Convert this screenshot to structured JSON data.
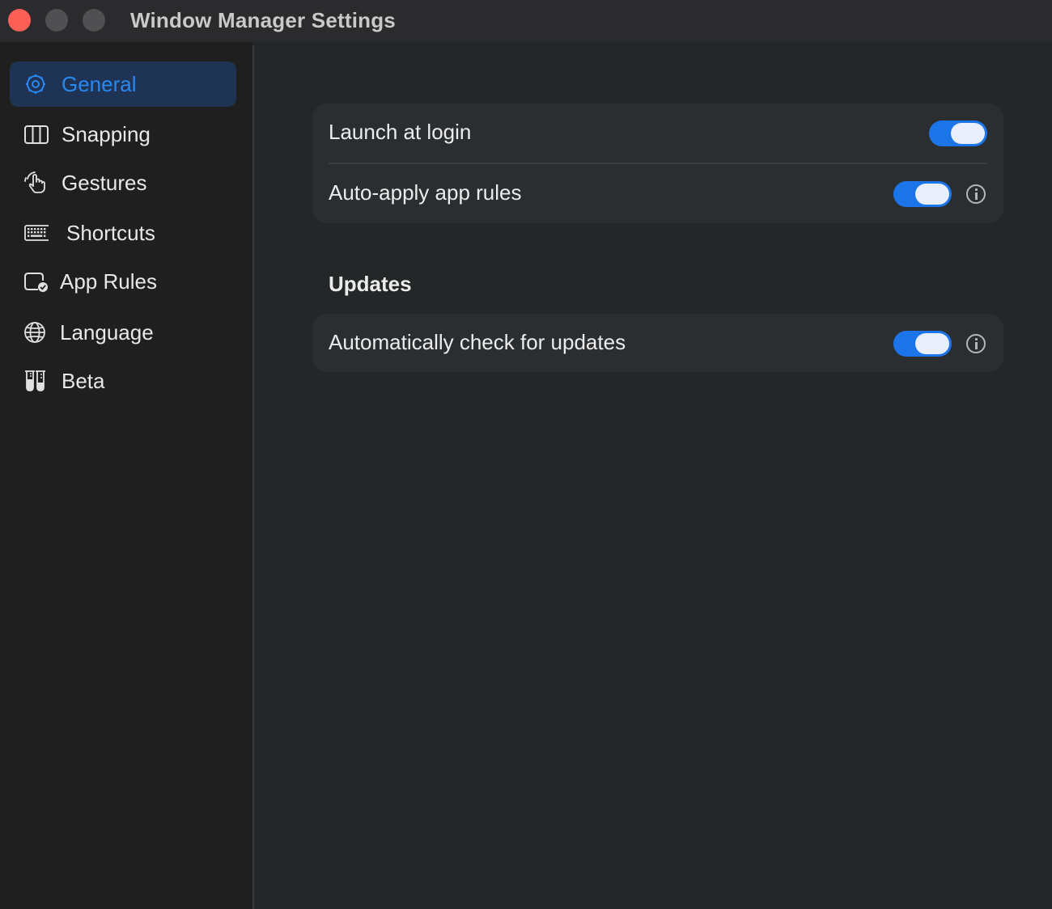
{
  "window": {
    "title": "Window Manager Settings"
  },
  "sidebar": {
    "items": [
      {
        "label": "General",
        "icon": "gear-icon",
        "active": true
      },
      {
        "label": "Snapping",
        "icon": "columns-icon",
        "active": false
      },
      {
        "label": "Gestures",
        "icon": "hand-pointer-icon",
        "active": false
      },
      {
        "label": "Shortcuts",
        "icon": "keyboard-icon",
        "active": false
      },
      {
        "label": "App Rules",
        "icon": "app-checkmark-icon",
        "active": false
      },
      {
        "label": "Language",
        "icon": "globe-icon",
        "active": false
      },
      {
        "label": "Beta",
        "icon": "test-tubes-icon",
        "active": false
      }
    ]
  },
  "general": {
    "launch_at_login": {
      "label": "Launch at login",
      "enabled": true
    },
    "auto_apply_app_rules": {
      "label": "Auto-apply app rules",
      "enabled": true,
      "info_icon": "info-icon"
    }
  },
  "updates": {
    "section_title": "Updates",
    "auto_check": {
      "label": "Automatically check for updates",
      "enabled": true,
      "info_icon": "info-icon"
    }
  },
  "colors": {
    "accent": "#1c74e9",
    "active_nav_text": "#2a88f3",
    "close_button": "#fe5f57"
  }
}
